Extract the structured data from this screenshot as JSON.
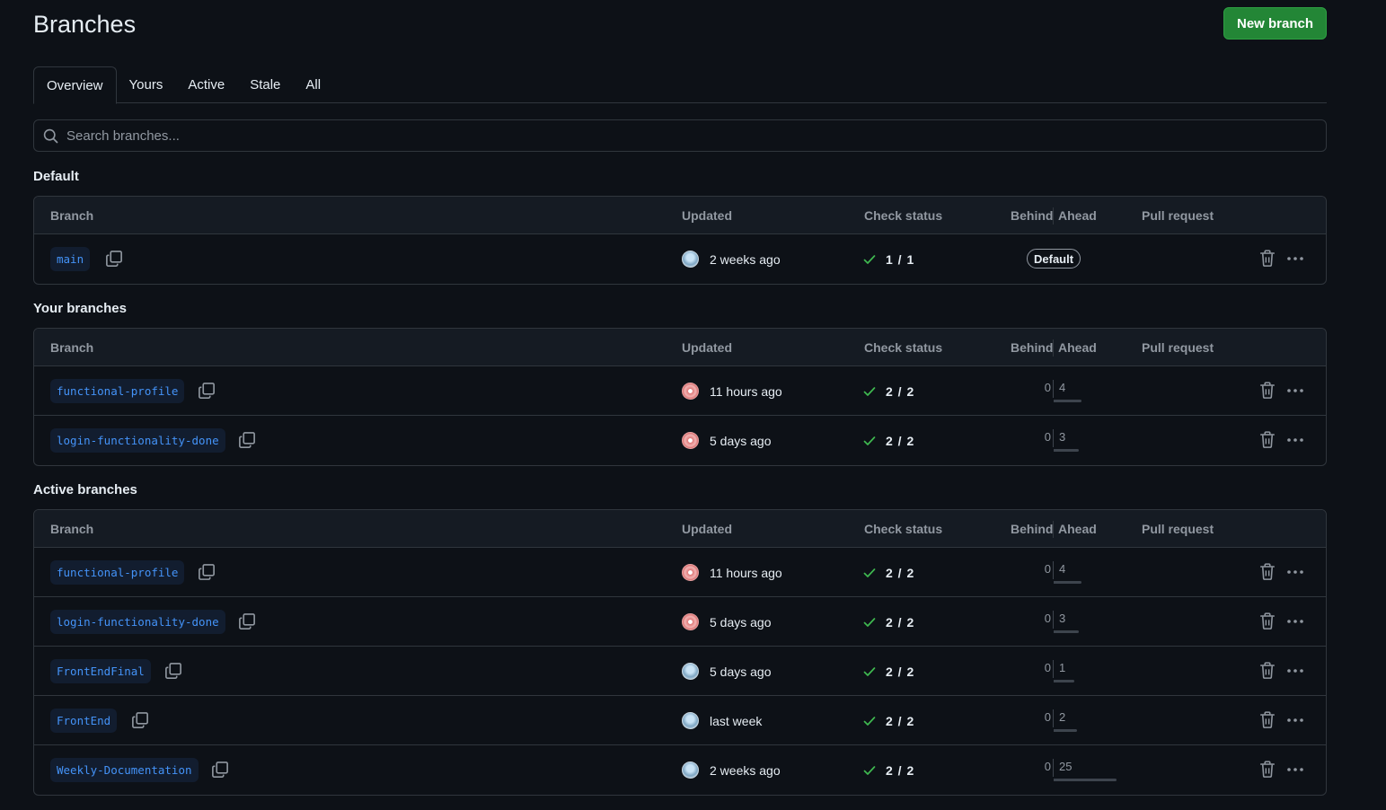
{
  "header": {
    "title": "Branches",
    "new_branch_label": "New branch"
  },
  "tabs": [
    "Overview",
    "Yours",
    "Active",
    "Stale",
    "All"
  ],
  "selected_tab": "Overview",
  "search": {
    "placeholder": "Search branches..."
  },
  "columns": {
    "branch": "Branch",
    "updated": "Updated",
    "check_status": "Check status",
    "behind": "Behind",
    "ahead": "Ahead",
    "pull_request": "Pull request"
  },
  "sections": [
    {
      "title": "Default",
      "rows": [
        {
          "name": "main",
          "avatar": "a1",
          "updated": "2 weeks ago",
          "check": "1 / 1",
          "default_badge": "Default"
        }
      ]
    },
    {
      "title": "Your branches",
      "rows": [
        {
          "name": "functional-profile",
          "avatar": "a2",
          "updated": "11 hours ago",
          "check": "2 / 2",
          "behind": "0",
          "ahead": "4"
        },
        {
          "name": "login-functionality-done",
          "avatar": "a2",
          "updated": "5 days ago",
          "check": "2 / 2",
          "behind": "0",
          "ahead": "3"
        }
      ]
    },
    {
      "title": "Active branches",
      "rows": [
        {
          "name": "functional-profile",
          "avatar": "a2",
          "updated": "11 hours ago",
          "check": "2 / 2",
          "behind": "0",
          "ahead": "4"
        },
        {
          "name": "login-functionality-done",
          "avatar": "a2",
          "updated": "5 days ago",
          "check": "2 / 2",
          "behind": "0",
          "ahead": "3"
        },
        {
          "name": "FrontEndFinal",
          "avatar": "a1",
          "updated": "5 days ago",
          "check": "2 / 2",
          "behind": "0",
          "ahead": "1"
        },
        {
          "name": "FrontEnd",
          "avatar": "a1",
          "updated": "last week",
          "check": "2 / 2",
          "behind": "0",
          "ahead": "2"
        },
        {
          "name": "Weekly-Documentation",
          "avatar": "a1",
          "updated": "2 weeks ago",
          "check": "2 / 2",
          "behind": "0",
          "ahead": "25"
        }
      ]
    }
  ],
  "icons": {
    "search": "search-icon",
    "copy": "copy-icon",
    "check": "check-icon",
    "trash": "trash-icon",
    "more": "kebab-horizontal-icon"
  },
  "colors": {
    "background": "#0d1117",
    "accent_green": "#238636",
    "link_blue": "#4493f8",
    "check_green": "#3fb950",
    "border": "#30363d"
  }
}
